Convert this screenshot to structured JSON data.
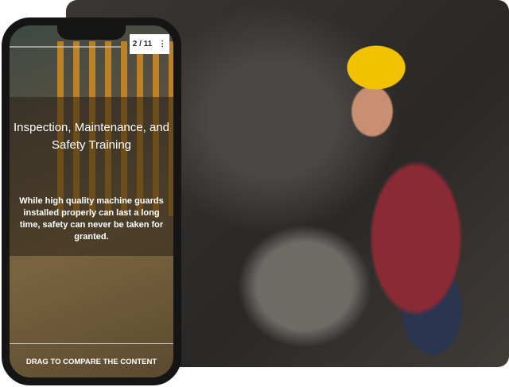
{
  "slide_counter": "2 / 11",
  "title_line1": "Inspection, Maintenance, and",
  "title_line2": "Safety Training",
  "body": "While high quality machine guards installed properly can last a long time, safety can never be taken for granted.",
  "drag_label": "DRAG TO COMPARE THE CONTENT"
}
